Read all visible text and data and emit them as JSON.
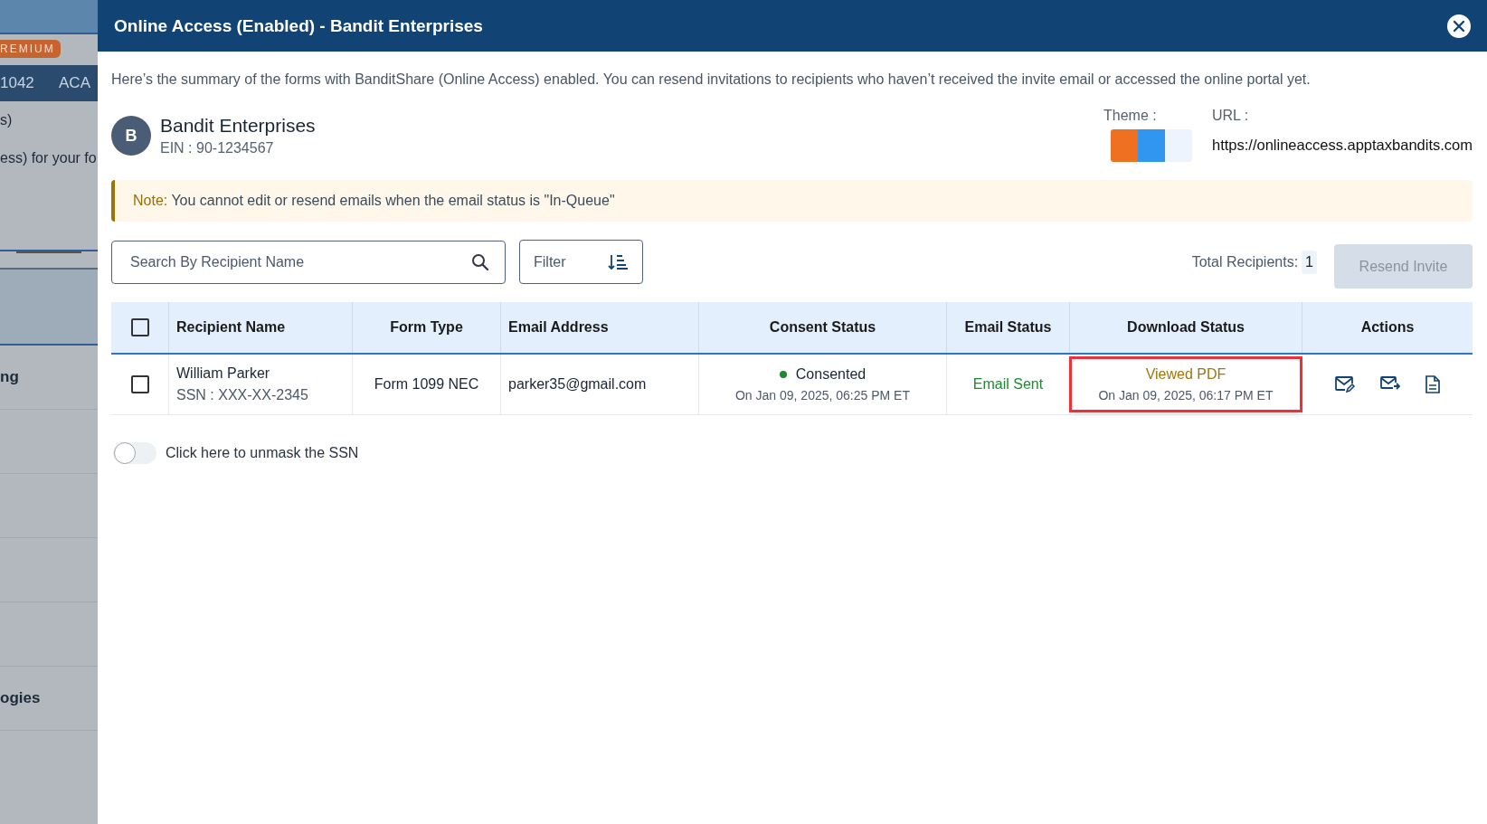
{
  "background_page": {
    "badge": "REMIUM",
    "tabs": [
      "1042",
      "ACA"
    ],
    "texts": [
      "s)",
      "ess) for your fo"
    ],
    "menu_items": [
      "ng",
      "ogies"
    ]
  },
  "modal": {
    "title": "Online Access (Enabled) - Bandit Enterprises",
    "description": "Here’s the summary of the forms with BanditShare (Online Access) enabled. You can resend invitations to recipients who haven’t received the invite email or accessed the online portal yet.",
    "company": {
      "initial": "B",
      "name": "Bandit Enterprises",
      "ein": "EIN : 90-1234567"
    },
    "theme": {
      "label": "Theme :",
      "swatches": [
        {
          "color": "#f07022"
        },
        {
          "color": "#3196ef"
        },
        {
          "color": "#eef4fd"
        }
      ]
    },
    "url": {
      "label": "URL :",
      "value": "https://onlineaccess.apptaxbandits.com"
    },
    "note": {
      "label": "Note:",
      "text": "You cannot edit or resend emails when the email status is \"In-Queue\""
    },
    "search": {
      "placeholder": "Search By Recipient Name"
    },
    "filter": {
      "label": "Filter"
    },
    "total": {
      "label": "Total Recipients:",
      "value": "1"
    },
    "resend_button": {
      "label": "Resend Invite",
      "disabled": true
    },
    "table": {
      "select_all": {
        "checked": false
      },
      "columns": [
        "Recipient Name",
        "Form Type",
        "Email Address",
        "Consent Status",
        "Email Status",
        "Download Status",
        "Actions"
      ],
      "rows": [
        {
          "checked": false,
          "name": "William Parker",
          "ssn": "SSN : XXX-XX-2345",
          "form_type": "Form 1099 NEC",
          "email": "parker35@gmail.com",
          "consent_status": "Consented",
          "consent_date": "On Jan 09, 2025, 06:25 PM ET",
          "email_status": "Email Sent",
          "download_status": "Viewed PDF",
          "download_date": "On Jan 09, 2025, 06:17 PM ET",
          "download_highlighted": true
        }
      ]
    },
    "unmask_toggle": {
      "label": "Click here to unmask the SSN",
      "on": false
    }
  }
}
